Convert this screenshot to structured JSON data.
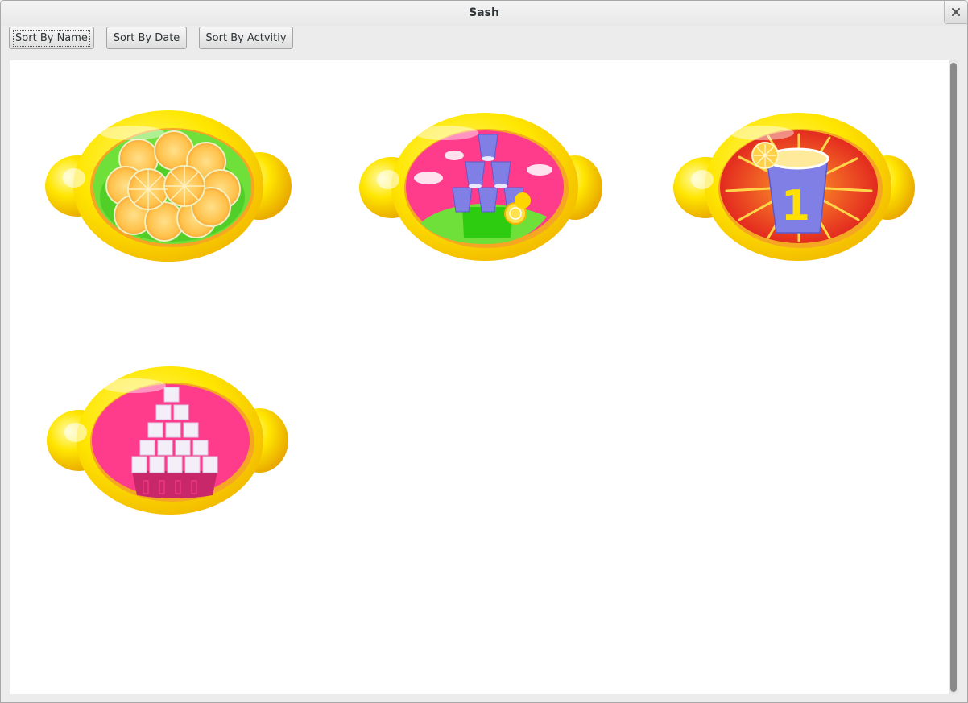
{
  "window": {
    "title": "Sash"
  },
  "toolbar": {
    "buttons": [
      {
        "label": "Sort By Name",
        "focused": true
      },
      {
        "label": "Sort By Date",
        "focused": false
      },
      {
        "label": "Sort By Actvitiy",
        "focused": false
      }
    ]
  },
  "badges": [
    {
      "icon": "lemon-slices-icon",
      "inner_color": "#66dd33"
    },
    {
      "icon": "cup-stack-icon",
      "inner_color": "#ff3c8c"
    },
    {
      "icon": "number-one-cup-icon",
      "inner_color": "#e8221e"
    },
    {
      "icon": "sugar-cube-pyramid-icon",
      "inner_color": "#ff3c8c"
    }
  ],
  "colors": {
    "badge_rim": "#ffe600",
    "badge_rim_dark": "#f5b400",
    "cup": "#7f7fe6"
  }
}
